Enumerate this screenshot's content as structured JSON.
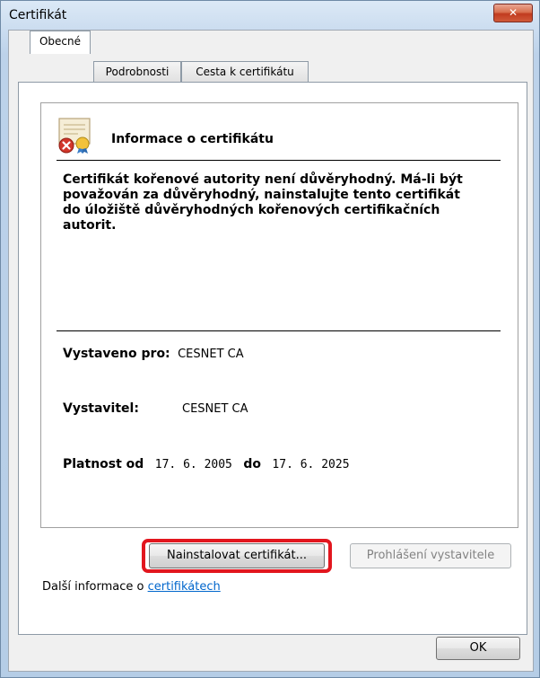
{
  "window": {
    "title": "Certifikát",
    "close_glyph": "✕"
  },
  "tabs": [
    {
      "label": "Obecné",
      "active": true
    },
    {
      "label": "Podrobnosti",
      "active": false
    },
    {
      "label": "Cesta k certifikátu",
      "active": false
    }
  ],
  "info": {
    "heading": "Informace o certifikátu",
    "warning": "Certifikát kořenové autority není důvěryhodný. Má-li být považován za důvěryhodný, nainstalujte tento certifikát do úložiště důvěryhodných kořenových certifikačních autorit.",
    "issued_to_label": "Vystaveno pro:",
    "issued_to_value": "CESNET CA",
    "issuer_label": "Vystavitel:",
    "issuer_value": "CESNET CA",
    "valid_from_label": "Platnost od",
    "valid_from_value": "17. 6. 2005",
    "valid_to_label": "do",
    "valid_to_value": "17. 6. 2025"
  },
  "buttons": {
    "install": "Nainstalovat certifikát...",
    "issuer_statement": "Prohlášení vystavitele",
    "ok": "OK"
  },
  "more_info": {
    "prefix": "Další informace o ",
    "link": "certifikátech"
  },
  "icons": {
    "certificate": "certificate-icon",
    "error": "error-icon"
  },
  "colors": {
    "highlight": "#e2161e",
    "link": "#0066cc"
  }
}
